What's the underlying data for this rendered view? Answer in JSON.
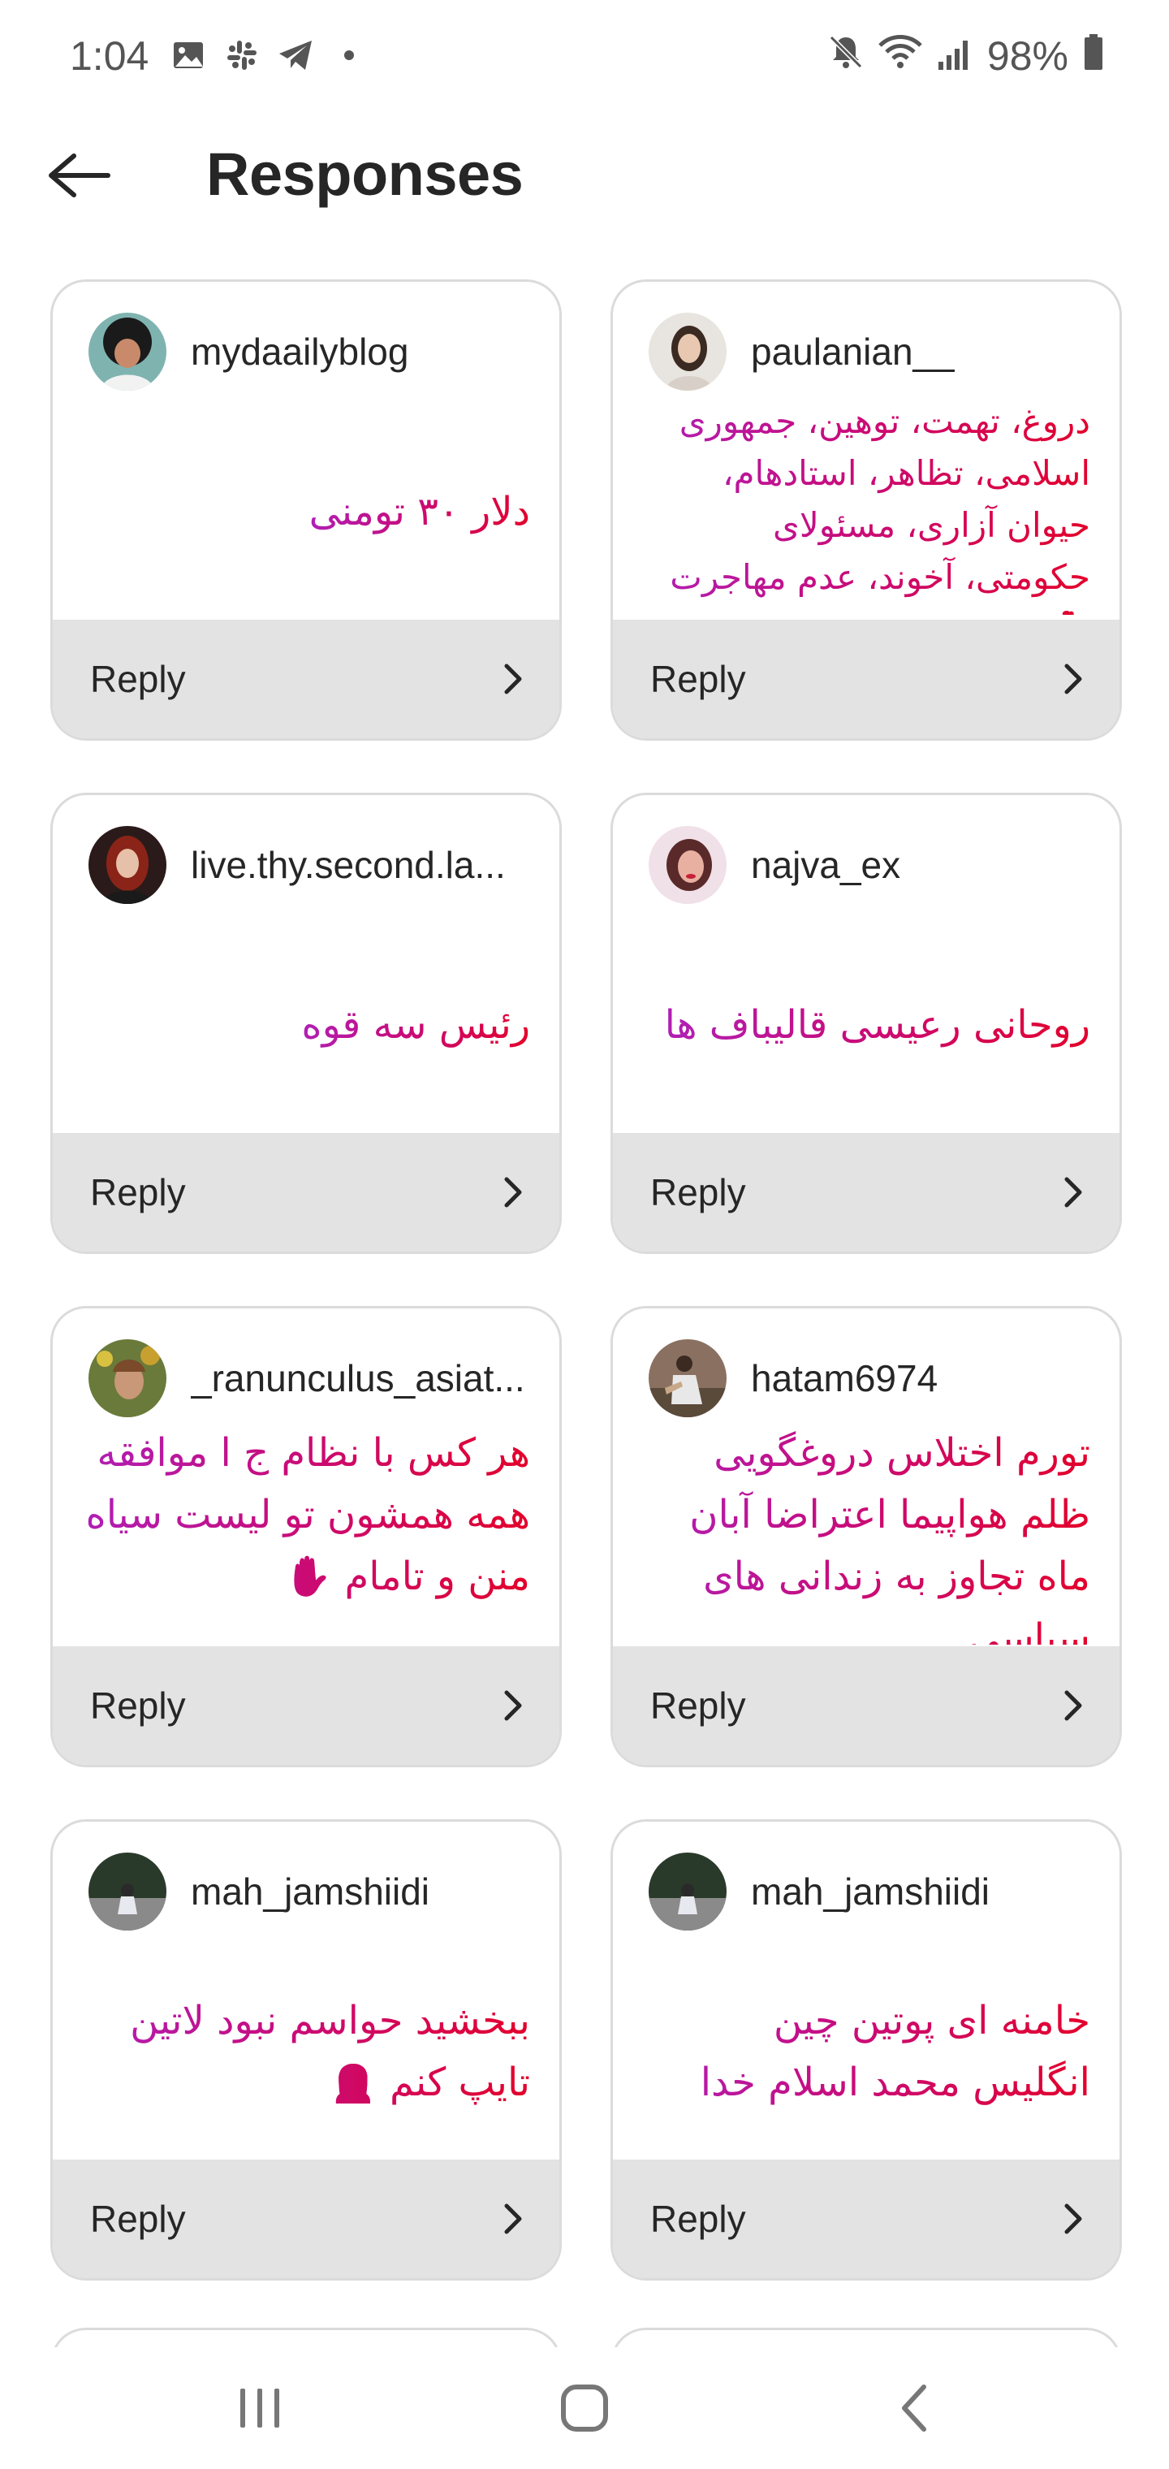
{
  "status_bar": {
    "time": "1:04",
    "battery": "98%",
    "left_icons": [
      "image-icon",
      "slack-icon",
      "telegram-icon",
      "dot-icon"
    ],
    "right_icons": [
      "mute-icon",
      "wifi-icon",
      "signal-icon",
      "battery-icon"
    ]
  },
  "header": {
    "title": "Responses"
  },
  "cards": [
    {
      "username": "mydaailyblog",
      "message": "دلار ۳۰ تومنی",
      "reply_label": "Reply"
    },
    {
      "username": "paulanian__",
      "message": "دروغ، تهمت، توهین، جمهوری اسلامی، تظاهر، استادهام، حیوان آزاری، مسئولای حکومتی، آخوند، عدم مهاجرت 🚶‍♀️",
      "reply_label": "Reply"
    },
    {
      "username": "live.thy.second.la...",
      "message": "رئیس سه قوه",
      "reply_label": "Reply"
    },
    {
      "username": "najva_ex",
      "message": "روحانی رعیسی قالیباف ها",
      "reply_label": "Reply"
    },
    {
      "username": "_ranunculus_asiat...",
      "message": "هر کس با نظام ج ا موافقه همه همشون تو لیست سیاه منن و تامام ✋",
      "reply_label": "Reply"
    },
    {
      "username": "hatam6974",
      "message": "تورم اختلاس دروغگویی ظلم هواپیما اعتراضا آبان ماه تجاوز به زندانی های سیاسی",
      "reply_label": "Reply"
    },
    {
      "username": "mah_jamshiidi",
      "message": "ببخشید حواسم نبود لاتین تایپ کنم 🙍‍♀️",
      "reply_label": "Reply"
    },
    {
      "username": "mah_jamshiidi",
      "message": "خامنه ای پوتین چین انگلیس محمد اسلام خدا",
      "reply_label": "Reply"
    }
  ],
  "nav": {
    "recents": "recents-icon",
    "home": "home-icon",
    "back": "back-icon"
  }
}
